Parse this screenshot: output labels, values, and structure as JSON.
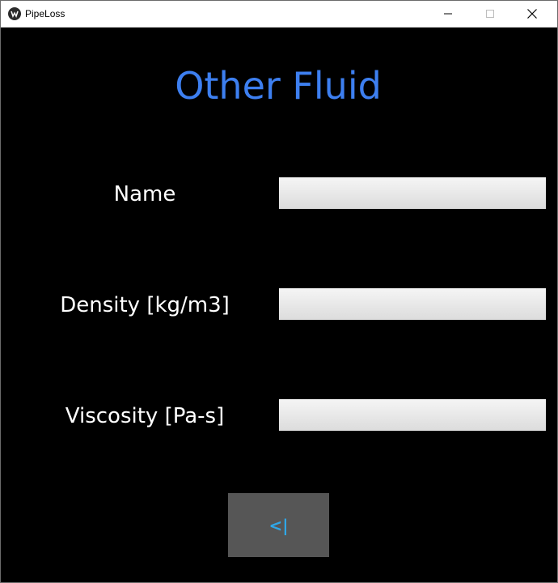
{
  "window": {
    "title": "PipeLoss",
    "controls": {
      "minimize_icon": "minimize-icon",
      "maximize_icon": "maximize-icon",
      "close_icon": "close-icon"
    }
  },
  "form": {
    "heading": "Other Fluid",
    "fields": [
      {
        "label": "Name",
        "value": "",
        "placeholder": ""
      },
      {
        "label": "Density [kg/m3]",
        "value": "",
        "placeholder": ""
      },
      {
        "label": "Viscosity [Pa-s]",
        "value": "",
        "placeholder": ""
      }
    ],
    "back_button_label": "<|"
  },
  "colors": {
    "background": "#000000",
    "heading": "#3d7ff0",
    "label": "#ffffff",
    "button_bg": "#565656",
    "button_text": "#2fa7e8"
  }
}
